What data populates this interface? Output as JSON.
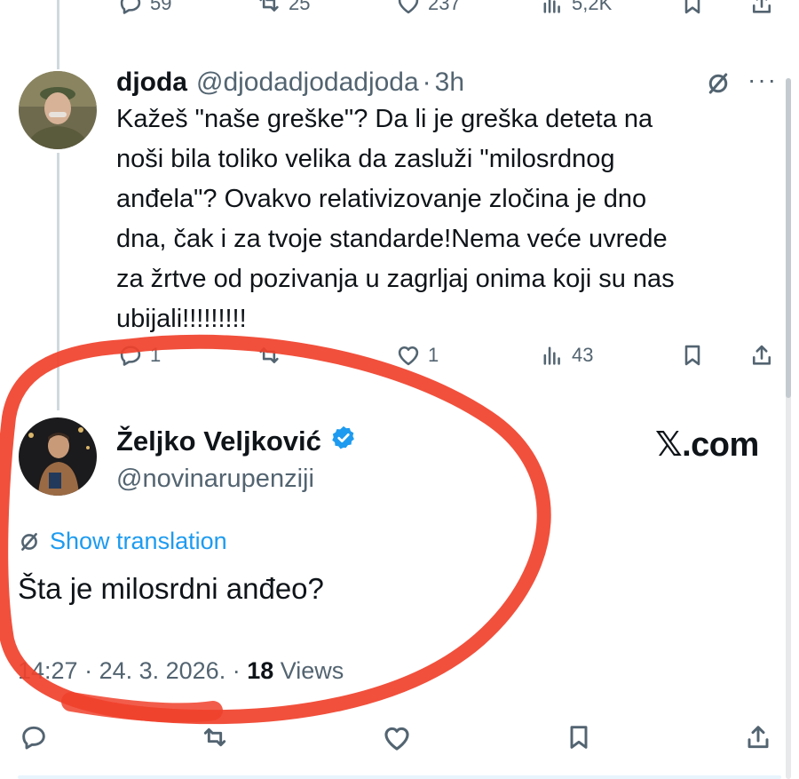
{
  "previous_tweet": {
    "stats": {
      "replies": "59",
      "retweets": "25",
      "likes": "237",
      "views": "5,2K"
    }
  },
  "reply_tweet": {
    "display_name": "djoda",
    "handle": "@djodadjodadjoda",
    "separator": "·",
    "time": "3h",
    "more": "···",
    "text": "Kažeš \"naše greške\"? Da li je greška deteta na\nnoši bila toliko velika da zasluži \"milosrdnog\nanđela\"? Ovakvo relativizovanje zločina je dno\ndna, čak i za tvoje standarde!Nema veće uvrede\nza žrtve od pozivanja u zagrljaj onima koji su nas\nubijali!!!!!!!!!",
    "stats": {
      "replies": "1",
      "likes": "1",
      "views": "43"
    }
  },
  "main_tweet": {
    "display_name": "Željko Veljković",
    "handle": "@novinarupenziji",
    "watermark": "𝕏.com",
    "show_translation": "Show translation",
    "text": "Šta je milosrdni anđeo?",
    "time": "14:27",
    "dot": " · ",
    "date": "24. 3. 2026.",
    "views_count": "18",
    "views_label": " Views"
  },
  "icons": [
    "reply-icon",
    "retweet-icon",
    "like-icon",
    "views-icon",
    "bookmark-icon",
    "share-icon",
    "translate-icon",
    "verified-icon",
    "more-icon"
  ],
  "colors": {
    "accent": "#1d9bf0",
    "muted": "#536471",
    "text": "#0f1419",
    "annotation": "#f0412b",
    "thread_line": "#cfd9de"
  }
}
